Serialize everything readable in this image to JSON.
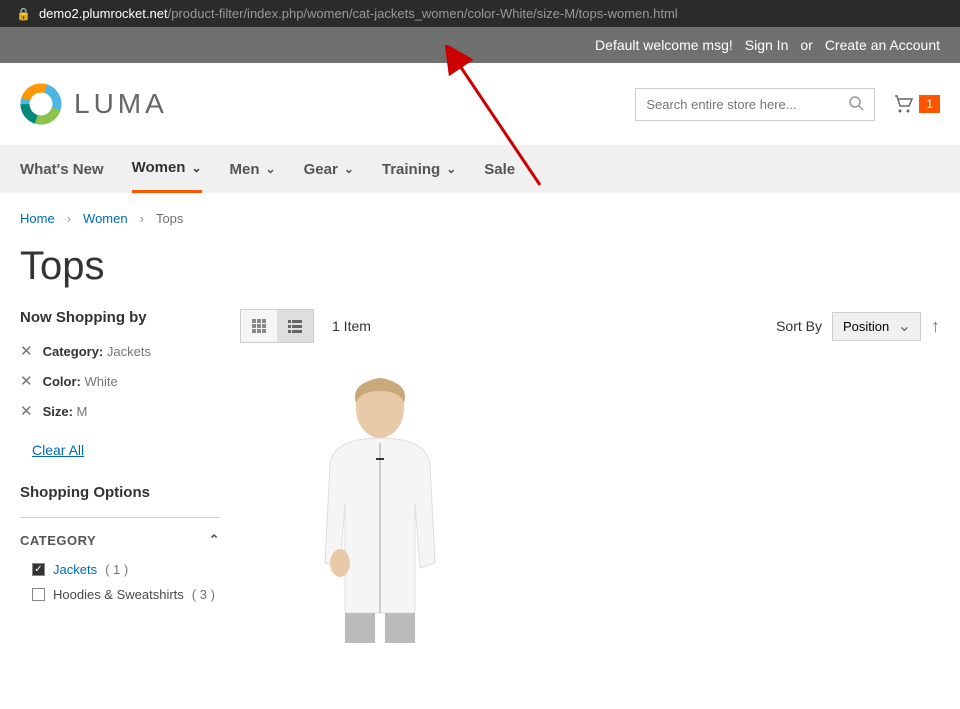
{
  "url": {
    "domain": "demo2.plumrocket.net",
    "path": "/product-filter/index.php/women/cat-jackets_women/color-White/size-M/tops-women.html"
  },
  "banner": {
    "welcome": "Default welcome msg!",
    "signin": "Sign In",
    "or": "or",
    "create": "Create an Account"
  },
  "logo_text": "LUMA",
  "search": {
    "placeholder": "Search entire store here..."
  },
  "cart_count": "1",
  "nav": [
    {
      "label": "What's New",
      "chevron": false
    },
    {
      "label": "Women",
      "chevron": true,
      "active": true
    },
    {
      "label": "Men",
      "chevron": true
    },
    {
      "label": "Gear",
      "chevron": true
    },
    {
      "label": "Training",
      "chevron": true
    },
    {
      "label": "Sale",
      "chevron": false
    }
  ],
  "breadcrumbs": [
    {
      "label": "Home",
      "link": true
    },
    {
      "label": "Women",
      "link": true
    },
    {
      "label": "Tops",
      "link": false
    }
  ],
  "page_title": "Tops",
  "sidebar": {
    "now_shopping": "Now Shopping by",
    "filters": [
      {
        "label": "Category:",
        "value": "Jackets"
      },
      {
        "label": "Color:",
        "value": "White"
      },
      {
        "label": "Size:",
        "value": "M"
      }
    ],
    "clear_all": "Clear All",
    "shopping_options": "Shopping Options",
    "category_header": "CATEGORY",
    "categories": [
      {
        "name": "Jackets",
        "count": "( 1 )",
        "checked": true
      },
      {
        "name": "Hoodies & Sweatshirts",
        "count": "( 3 )",
        "checked": false
      }
    ]
  },
  "toolbar": {
    "item_count": "1 Item",
    "sort_label": "Sort By",
    "sort_value": "Position"
  }
}
